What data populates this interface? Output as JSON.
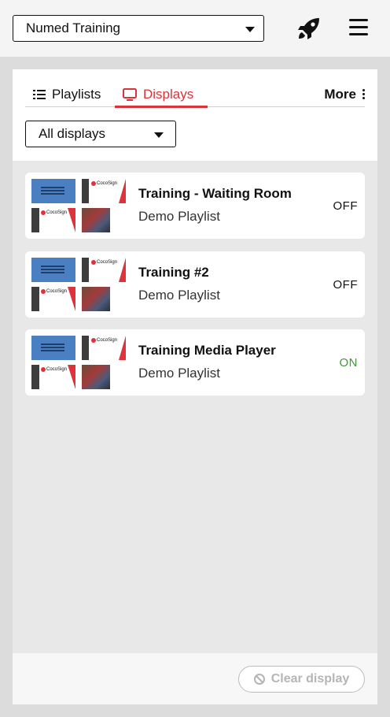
{
  "header": {
    "organization": "Numed Training",
    "rocket_icon": "rocket-icon",
    "menu_icon": "hamburger-menu-icon"
  },
  "tabs": {
    "playlists": "Playlists",
    "displays": "Displays",
    "more": "More",
    "active": "Displays",
    "accent_color": "#d9343a"
  },
  "filter": {
    "selected": "All displays"
  },
  "displays": [
    {
      "name": "Training - Waiting Room",
      "playlist": "Demo Playlist",
      "status": "OFF"
    },
    {
      "name": "Training #2",
      "playlist": "Demo Playlist",
      "status": "OFF"
    },
    {
      "name": "Training Media Player",
      "playlist": "Demo Playlist",
      "status": "ON"
    }
  ],
  "thumbnail": {
    "logo_text": "CocoSign"
  },
  "footer": {
    "clear_label": "Clear display",
    "clear_enabled": false
  },
  "colors": {
    "on_status": "#3e9a32",
    "off_status": "#111111"
  }
}
